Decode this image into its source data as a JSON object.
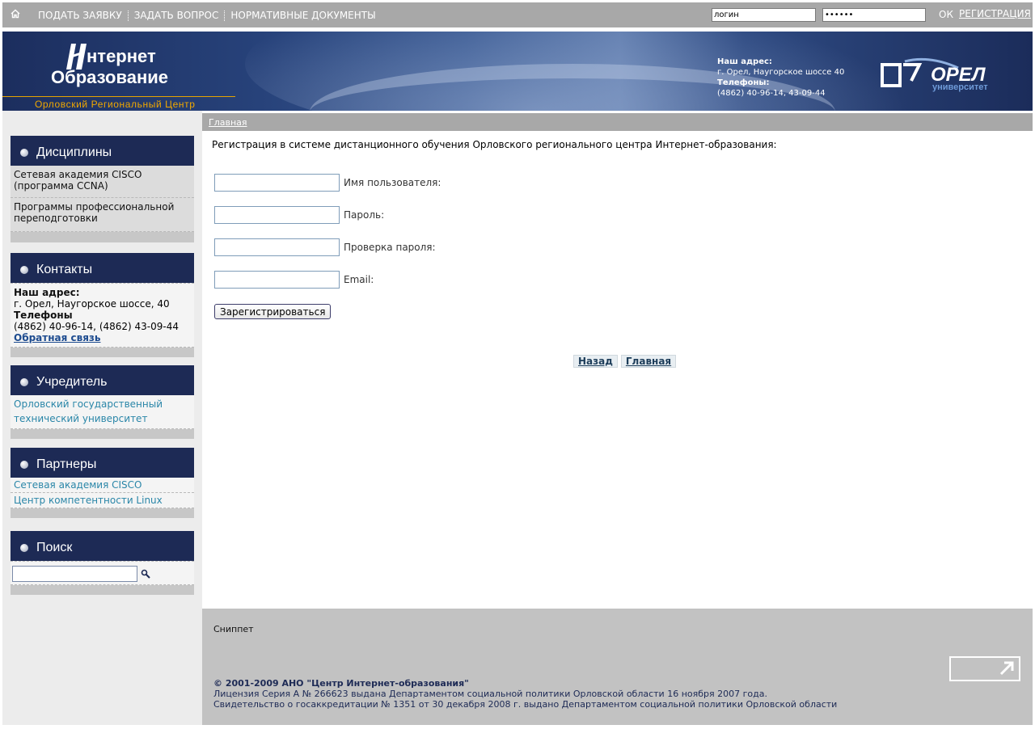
{
  "topbar": {
    "nav": [
      "ПОДАТЬ ЗАЯВКУ",
      "ЗАДАТЬ ВОПРОС",
      "НОРМАТИВНЫЕ ДОКУМЕНТЫ"
    ],
    "login_value": "логин",
    "password_value": "••••••",
    "ok_label": "ОК",
    "register_label": "РЕГИСТРАЦИЯ"
  },
  "header": {
    "logo_line1": "нтернет",
    "logo_line2": "Образование",
    "logo_sub": "Орловский Региональный Центр",
    "addr_label": "Наш адрес:",
    "addr_value": "г. Орел, Наугорское шоссе 40",
    "phones_label": "Телефоны:",
    "phones_value": "(4862) 40-96-14, 43-09-44",
    "uni_logo_text": "ОРЕЛ",
    "uni_logo_sub": "университет"
  },
  "sidebar": {
    "disciplines": {
      "title": "Дисциплины",
      "items": [
        "Сетевая академия CISCO (программа CCNA)",
        "Программы профессиональной переподготовки"
      ]
    },
    "contacts": {
      "title": "Контакты",
      "addr_label": "Наш адрес:",
      "addr_value": "г. Орел, Наугорское шоссе, 40",
      "phones_label": "Телефоны",
      "phones_value": "(4862) 40-96-14, (4862) 43-09-44",
      "feedback": "Обратная связь"
    },
    "founder": {
      "title": "Учредитель",
      "items": [
        "Орловский государственный технический университет"
      ]
    },
    "partners": {
      "title": "Партнеры",
      "items": [
        "Сетевая академия CISCO",
        "Центр компетентности Linux"
      ]
    },
    "search": {
      "title": "Поиск",
      "value": ""
    }
  },
  "main": {
    "breadcrumb": "Главная",
    "title": "Регистрация в системе дистанционного обучения Орловского регионального центра Интернет-образования:",
    "fields": [
      "Имя пользователя:",
      "Пароль:",
      "Проверка пароля:",
      "Email:"
    ],
    "submit": "Зарегистрироваться",
    "back": "Назад",
    "home": "Главная"
  },
  "footer": {
    "snippet": "Сниппет",
    "copyright": "© 2001-2009 АНО \"Центр Интернет-образования\"",
    "license": "Лицензия Серия А № 266623 выдана Департаментом социальной политики Орловской области 16 ноября 2007 года.",
    "accreditation": "Свидетельство о госаккредитации № 1351 от 30 декабря 2008 г. выдано Департаментом социальной политики Орловской области"
  },
  "colors": {
    "sidebar_head": "#1d2a55",
    "topbar": "#a8a8a8",
    "accent_orange": "#f0a800",
    "link_teal": "#2a86a8"
  },
  "icons": [
    "home-icon",
    "search-icon",
    "counter-arrow-icon",
    "bullet-icon"
  ]
}
